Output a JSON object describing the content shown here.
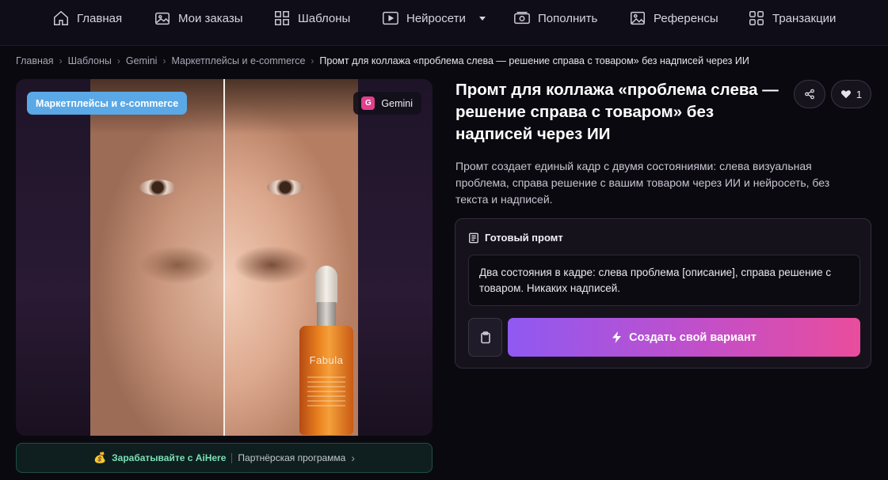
{
  "nav": {
    "items": [
      {
        "label": "Главная",
        "icon": "home-icon"
      },
      {
        "label": "Мои заказы",
        "icon": "images-icon"
      },
      {
        "label": "Шаблоны",
        "icon": "grid-icon"
      },
      {
        "label": "Нейросети",
        "icon": "play-icon"
      },
      {
        "label": "Пополнить",
        "icon": "wallet-icon"
      },
      {
        "label": "Референсы",
        "icon": "image-icon"
      },
      {
        "label": "Транзакции",
        "icon": "apps-icon"
      }
    ]
  },
  "breadcrumb": {
    "items": [
      "Главная",
      "Шаблоны",
      "Gemini",
      "Маркетплейсы и e-commerce"
    ],
    "current": "Промт для коллажа «проблема слева — решение справа с товаром» без надписей через ИИ"
  },
  "image_card": {
    "category_badge": "Маркетплейсы и e-commerce",
    "model_badge": "Gemini",
    "model_icon_letter": "G",
    "product_brand": "Fabula"
  },
  "partner": {
    "earn_text": "Зарабатывайте с AiHere",
    "program_text": "Партнёрская программа"
  },
  "detail": {
    "title": "Промт для коллажа «проблема слева — решение справа с товаром» без надписей через ИИ",
    "likes": "1",
    "description": "Промт создает единый кадр с двумя состояниями: слева визуальная проблема, справа решение с вашим товаром через ИИ и нейросеть, без текста и надписей.",
    "prompt_heading": "Готовый промт",
    "prompt_text": "Два состояния в кадре: слева проблема [описание], справа решение с товаром. Никаких надписей.",
    "create_button": "Создать свой вариант"
  },
  "colors": {
    "accent_gradient_start": "#8f59f2",
    "accent_gradient_end": "#e94d9c",
    "category_badge": "#5aa8e6",
    "partner_text": "#7be0b7"
  }
}
